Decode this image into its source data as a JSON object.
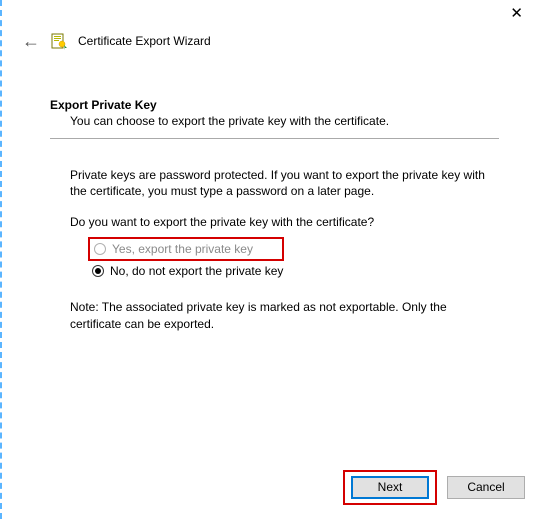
{
  "window": {
    "title": "Certificate Export Wizard"
  },
  "section": {
    "heading": "Export Private Key",
    "subheading": "You can choose to export the private key with the certificate."
  },
  "body": {
    "intro": "Private keys are password protected. If you want to export the private key with the certificate, you must type a password on a later page.",
    "prompt": "Do you want to export the private key with the certificate?",
    "note": "Note: The associated private key is marked as not exportable. Only the certificate can be exported."
  },
  "options": {
    "yes": "Yes, export the private key",
    "no": "No, do not export the private key"
  },
  "buttons": {
    "next": "Next",
    "cancel": "Cancel"
  }
}
